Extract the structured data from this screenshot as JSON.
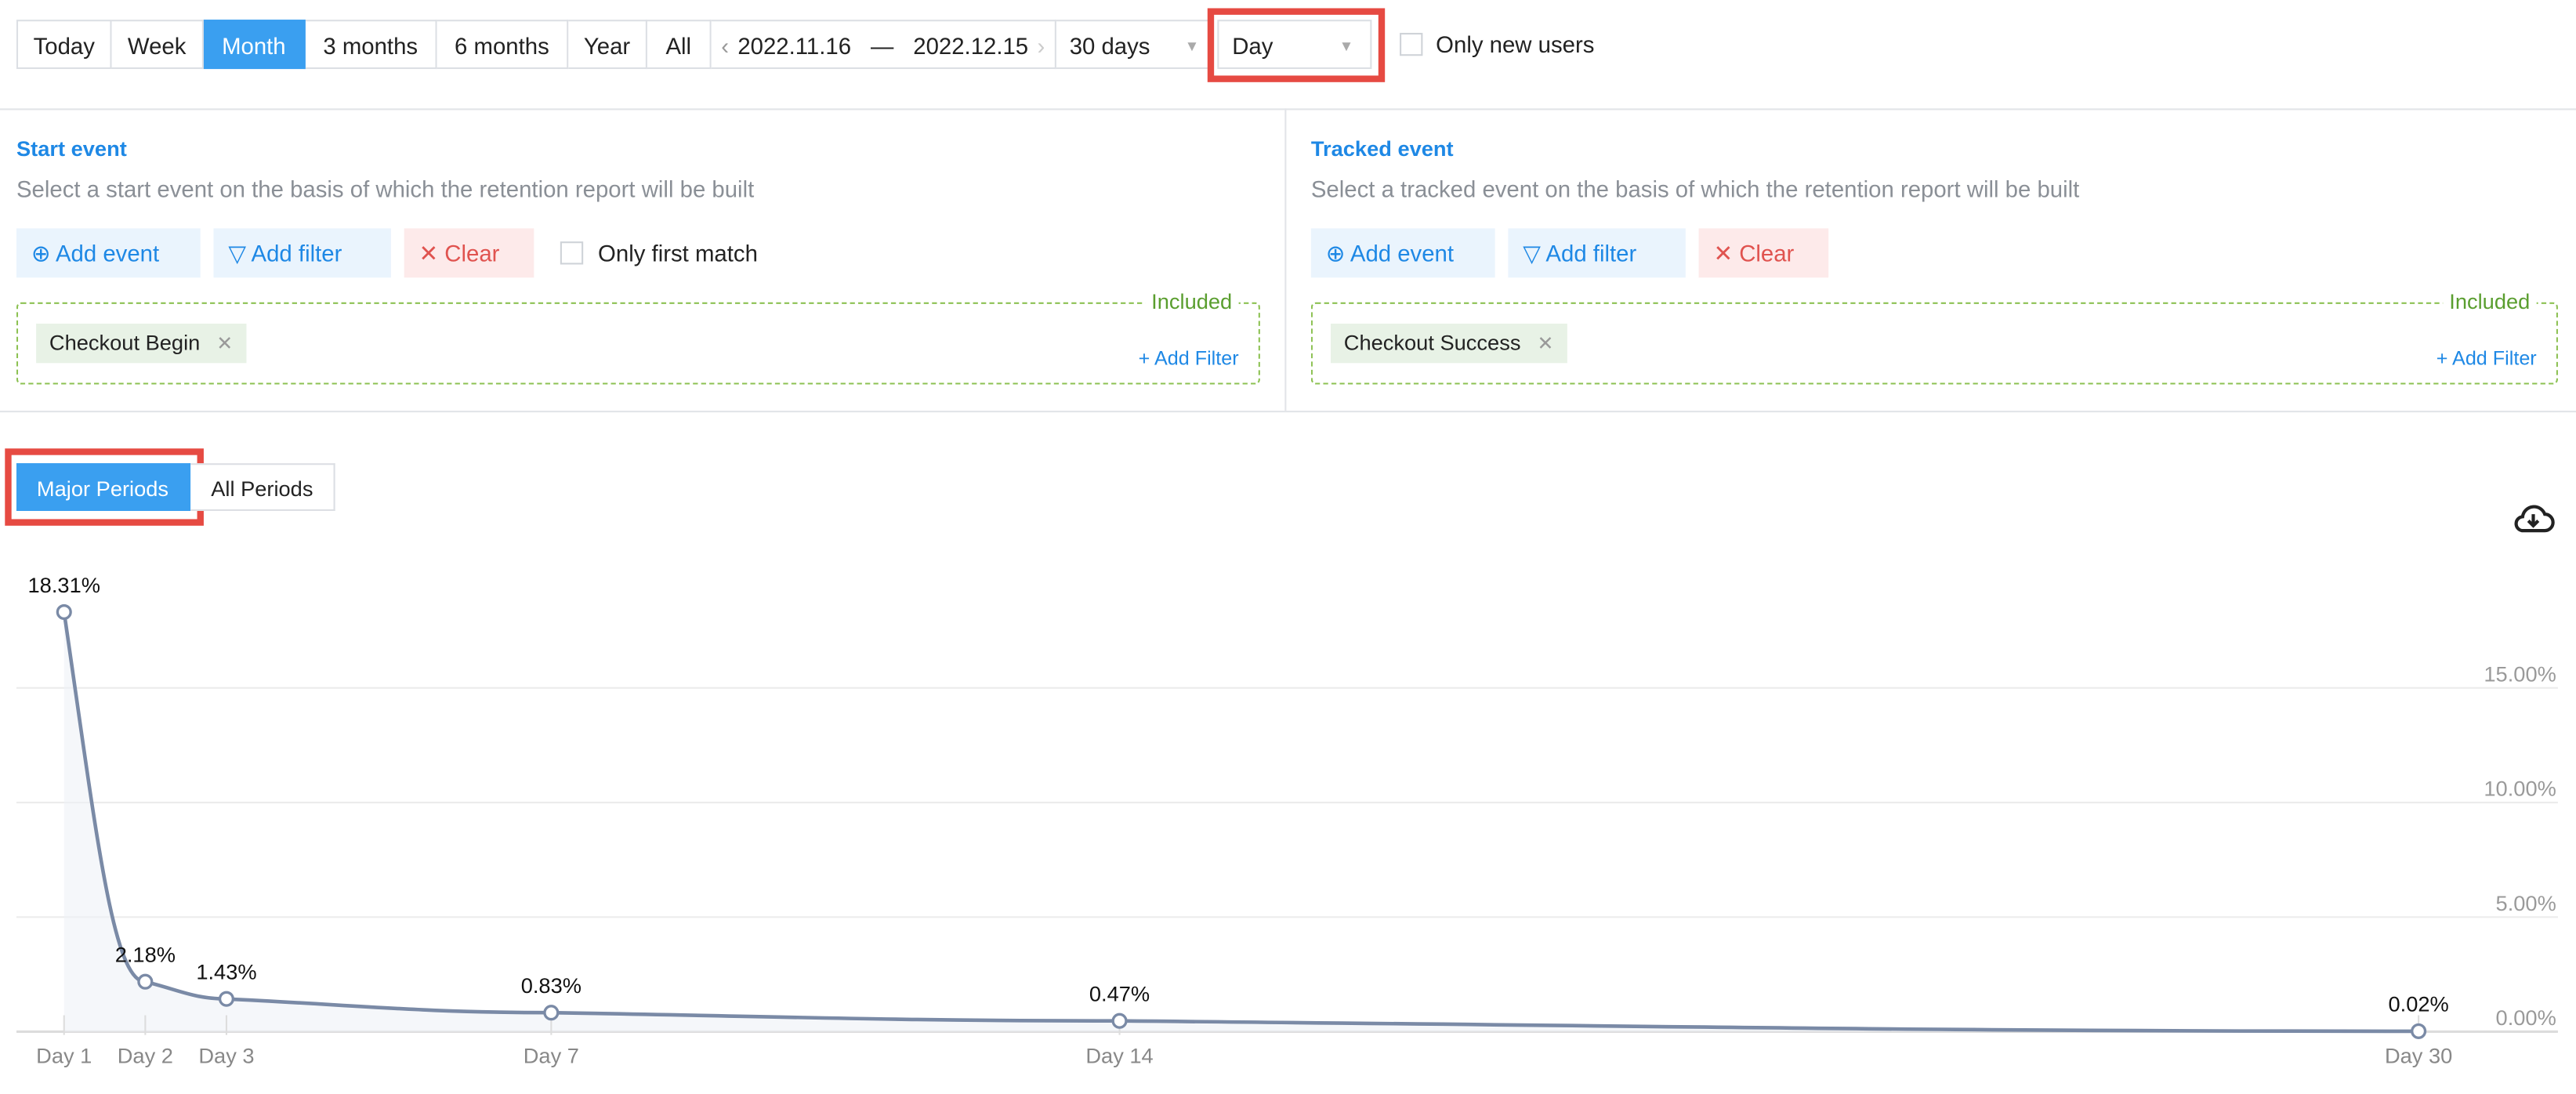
{
  "toolbar": {
    "periods": [
      "Today",
      "Week",
      "Month",
      "3 months",
      "6 months",
      "Year",
      "All"
    ],
    "active_period": "Month",
    "date_from": "2022.11.16",
    "date_sep": "—",
    "date_to": "2022.12.15",
    "range": "30 days",
    "granularity": "Day",
    "only_new_users": "Only new users"
  },
  "start_panel": {
    "title": "Start event",
    "description": "Select a start event on the basis of which the retention report will be built",
    "add_event": "Add event",
    "add_filter": "Add filter",
    "clear": "Clear",
    "only_first": "Only first match",
    "included": "Included",
    "tag": "Checkout Begin",
    "tag_add_filter": "+ Add Filter"
  },
  "tracked_panel": {
    "title": "Tracked event",
    "description": "Select a tracked event on the basis of which the retention report will be built",
    "add_event": "Add event",
    "add_filter": "Add filter",
    "clear": "Clear",
    "included": "Included",
    "tag": "Checkout Success",
    "tag_add_filter": "+ Add Filter"
  },
  "view_tabs": {
    "major": "Major Periods",
    "all": "All Periods"
  },
  "colors": {
    "accent": "#3a9ff0",
    "line": "#7a8aa6",
    "highlight": "#e64a42"
  },
  "chart_data": {
    "type": "line",
    "x": [
      1,
      2,
      3,
      7,
      14,
      30
    ],
    "categories": [
      "Day 1",
      "Day 2",
      "Day 3",
      "Day 7",
      "Day 14",
      "Day 30"
    ],
    "values": [
      18.31,
      2.18,
      1.43,
      0.83,
      0.47,
      0.02
    ],
    "labels": [
      "18.31%",
      "2.18%",
      "1.43%",
      "0.83%",
      "0.47%",
      "0.02%"
    ],
    "yticks": [
      0,
      5,
      10,
      15
    ],
    "ytick_labels": [
      "0.00%",
      "5.00%",
      "10.00%",
      "15.00%"
    ],
    "ylim": [
      0,
      18.31
    ],
    "grid": true,
    "ylabel": "",
    "xlabel": "",
    "title": ""
  }
}
